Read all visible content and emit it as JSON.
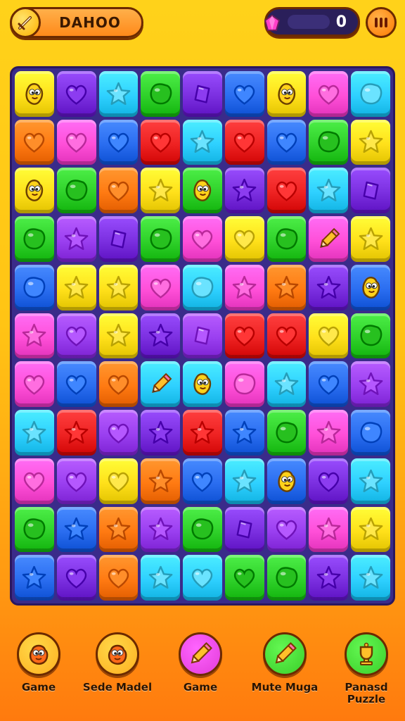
{
  "header": {
    "title": "DAHOO",
    "score": "0"
  },
  "colors": {
    "yellow": "#ffe01a",
    "pink": "#ff4fd8",
    "cyan": "#2ed0ff",
    "green": "#2fd12a",
    "purple": "#7b2fe0",
    "blue": "#2a6df0",
    "orange": "#ff7a12",
    "red": "#ee2222",
    "violet": "#9a3ff0"
  },
  "board": {
    "rows": [
      [
        [
          "yellow",
          "creature"
        ],
        [
          "purple",
          "heart"
        ],
        [
          "cyan",
          "star"
        ],
        [
          "green",
          "blob"
        ],
        [
          "purple",
          "diamond"
        ],
        [
          "blue",
          "heart"
        ],
        [
          "yellow",
          "creature"
        ],
        [
          "pink",
          "heart"
        ],
        [
          "cyan",
          "blob"
        ]
      ],
      [
        [
          "orange",
          "heart"
        ],
        [
          "pink",
          "heart"
        ],
        [
          "blue",
          "heart"
        ],
        [
          "red",
          "heart"
        ],
        [
          "cyan",
          "star"
        ],
        [
          "red",
          "heart"
        ],
        [
          "blue",
          "heart"
        ],
        [
          "green",
          "blob"
        ],
        [
          "yellow",
          "star"
        ]
      ],
      [
        [
          "yellow",
          "creature"
        ],
        [
          "green",
          "blob"
        ],
        [
          "orange",
          "heart"
        ],
        [
          "yellow",
          "star"
        ],
        [
          "green",
          "creature"
        ],
        [
          "purple",
          "star"
        ],
        [
          "red",
          "heart"
        ],
        [
          "cyan",
          "star"
        ],
        [
          "purple",
          "diamond"
        ]
      ],
      [
        [
          "green",
          "blob"
        ],
        [
          "violet",
          "star"
        ],
        [
          "purple",
          "diamond"
        ],
        [
          "green",
          "blob"
        ],
        [
          "pink",
          "heart"
        ],
        [
          "yellow",
          "heart"
        ],
        [
          "green",
          "blob"
        ],
        [
          "pink",
          "pencil"
        ],
        [
          "yellow",
          "star"
        ]
      ],
      [
        [
          "blue",
          "blob"
        ],
        [
          "yellow",
          "star"
        ],
        [
          "yellow",
          "star"
        ],
        [
          "pink",
          "heart"
        ],
        [
          "cyan",
          "blob"
        ],
        [
          "pink",
          "star"
        ],
        [
          "orange",
          "star"
        ],
        [
          "purple",
          "star"
        ],
        [
          "blue",
          "creature"
        ]
      ],
      [
        [
          "pink",
          "star"
        ],
        [
          "violet",
          "heart"
        ],
        [
          "yellow",
          "star"
        ],
        [
          "purple",
          "star"
        ],
        [
          "violet",
          "diamond"
        ],
        [
          "red",
          "heart"
        ],
        [
          "red",
          "heart"
        ],
        [
          "yellow",
          "heart"
        ],
        [
          "green",
          "blob"
        ]
      ],
      [
        [
          "pink",
          "heart"
        ],
        [
          "blue",
          "heart"
        ],
        [
          "orange",
          "heart"
        ],
        [
          "cyan",
          "pencil"
        ],
        [
          "cyan",
          "creature"
        ],
        [
          "pink",
          "blob"
        ],
        [
          "cyan",
          "star"
        ],
        [
          "blue",
          "heart"
        ],
        [
          "violet",
          "star"
        ]
      ],
      [
        [
          "cyan",
          "star"
        ],
        [
          "red",
          "star"
        ],
        [
          "violet",
          "heart"
        ],
        [
          "purple",
          "star"
        ],
        [
          "red",
          "star"
        ],
        [
          "blue",
          "star"
        ],
        [
          "green",
          "blob"
        ],
        [
          "pink",
          "star"
        ],
        [
          "blue",
          "blob"
        ]
      ],
      [
        [
          "pink",
          "heart"
        ],
        [
          "violet",
          "heart"
        ],
        [
          "yellow",
          "heart"
        ],
        [
          "orange",
          "star"
        ],
        [
          "blue",
          "heart"
        ],
        [
          "cyan",
          "star"
        ],
        [
          "blue",
          "creature"
        ],
        [
          "purple",
          "heart"
        ],
        [
          "cyan",
          "star"
        ]
      ],
      [
        [
          "green",
          "blob"
        ],
        [
          "blue",
          "star"
        ],
        [
          "orange",
          "star"
        ],
        [
          "violet",
          "star"
        ],
        [
          "green",
          "blob"
        ],
        [
          "purple",
          "diamond"
        ],
        [
          "violet",
          "heart"
        ],
        [
          "pink",
          "star"
        ],
        [
          "yellow",
          "star"
        ]
      ],
      [
        [
          "blue",
          "star"
        ],
        [
          "purple",
          "heart"
        ],
        [
          "orange",
          "heart"
        ],
        [
          "cyan",
          "star"
        ],
        [
          "cyan",
          "heart"
        ],
        [
          "green",
          "heart"
        ],
        [
          "green",
          "blob"
        ],
        [
          "purple",
          "star"
        ],
        [
          "cyan",
          "star"
        ]
      ]
    ]
  },
  "nav": {
    "items": [
      {
        "label": "Game",
        "icon": "creature-icon",
        "color": "#ffb020"
      },
      {
        "label": "Sede Madel",
        "icon": "creature-icon",
        "color": "#ffb020"
      },
      {
        "label": "Game",
        "icon": "pencil-icon",
        "color": "#e23cd8"
      },
      {
        "label": "Mute Muga",
        "icon": "pencil-icon",
        "color": "#3bcf2a"
      },
      {
        "label": "Panasd Puzzle",
        "icon": "trophy-icon",
        "color": "#3bcf2a"
      }
    ]
  }
}
